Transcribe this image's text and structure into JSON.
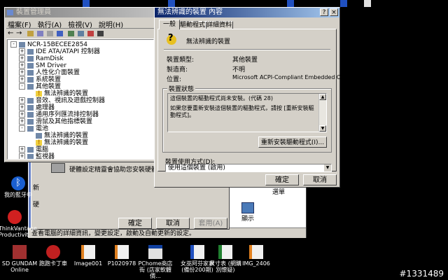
{
  "device_manager": {
    "title": "裝置管理員",
    "menu": [
      "檔案(F)",
      "執行(A)",
      "檢視(V)",
      "說明(H)"
    ],
    "tree": [
      {
        "label": "NCR-15BECEE2854",
        "level": 0,
        "exp": "-"
      },
      {
        "label": "IDE ATA/ATAPI 控制器",
        "level": 1,
        "exp": "+"
      },
      {
        "label": "RamDisk",
        "level": 1,
        "exp": "+"
      },
      {
        "label": "SM Driver",
        "level": 1,
        "exp": "+"
      },
      {
        "label": "人性化介面裝置",
        "level": 1,
        "exp": "+"
      },
      {
        "label": "系統裝置",
        "level": 1,
        "exp": "+"
      },
      {
        "label": "其他裝置",
        "level": 1,
        "exp": "-"
      },
      {
        "label": "無法辨識的裝置",
        "level": 2,
        "exp": "",
        "warn": true
      },
      {
        "label": "音效、視訊及遊戲控制器",
        "level": 1,
        "exp": "+"
      },
      {
        "label": "處理器",
        "level": 1,
        "exp": "+"
      },
      {
        "label": "通用序列匯流排控制器",
        "level": 1,
        "exp": "+"
      },
      {
        "label": "滑鼠及其他指標裝置",
        "level": 1,
        "exp": "+"
      },
      {
        "label": "電池",
        "level": 1,
        "exp": "-"
      },
      {
        "label": "無法辨識的裝置",
        "level": 2,
        "exp": ""
      },
      {
        "label": "無法辨識的裝置",
        "level": 2,
        "exp": "",
        "warn": true
      },
      {
        "label": "電腦",
        "level": 1,
        "exp": "+"
      },
      {
        "label": "監視器",
        "level": 1,
        "exp": "+"
      }
    ]
  },
  "background_dialog": {
    "text": "硬體設定精靈會協助您安裝硬體 (不宜",
    "left_label": "新",
    "left_label2": "硬",
    "ok": "確定",
    "cancel": "取消",
    "apply": "套用(A)"
  },
  "control_panel": {
    "status": "查看電腦的詳細資訊，變更設定，啟動及自動更新的設定。",
    "item_label": "顯示",
    "item_label2": "選單"
  },
  "properties": {
    "title": "無法辨識的裝置 內容",
    "tabs": [
      "一般",
      "驅動程式",
      "詳細資料"
    ],
    "device_name": "無法辨識的裝置",
    "fields": [
      {
        "label": "裝置類型:",
        "value": "其他裝置"
      },
      {
        "label": "製造商:",
        "value": "不明"
      },
      {
        "label": "位置:",
        "value": "Microsoft ACPI-Compliant Embedded Controller"
      }
    ],
    "status_group": "裝置狀態",
    "status_text1": "這個裝置的驅動程式尚未安裝。(代碼 28)",
    "status_text2": "如果您要重新安裝這個裝置的驅動程式，請按 [重新安裝驅動程式]。",
    "reinstall_button": "重新安裝驅動程式(I)...",
    "usage_label": "裝置使用方式(D):",
    "usage_value": "使用這個裝置 (啟用)",
    "ok": "確定",
    "cancel": "取消"
  },
  "desktop": {
    "left_icons": [
      {
        "label": "我的藍牙中",
        "icon": "bluetooth-icon",
        "color": "#1a5fd0"
      },
      {
        "label": "ThinkVantage Productivit...",
        "icon": "thinkvantage-icon",
        "color": "#d02020"
      }
    ],
    "bottom_icons": [
      {
        "label": "SD GUNDAM Online",
        "icon": "gundam-icon",
        "color": "#a03030"
      },
      {
        "label": "跑跑卡丁車",
        "icon": "kart-icon",
        "color": "#c02020"
      },
      {
        "label": "Image001",
        "icon": "image-file-icon",
        "color": "#e08020"
      },
      {
        "label": "P1020978",
        "icon": "image-file-icon",
        "color": "#e08020"
      },
      {
        "label": "PChome商店街 (店家軟體價...",
        "icon": "pchome-icon",
        "color": "#1040a0"
      },
      {
        "label": "女巫阿芬家事 (備份200期)",
        "icon": "word-icon",
        "color": "#2050c0"
      },
      {
        "label": "尺寸表 (網購別懷疑)",
        "icon": "spreadsheet-icon",
        "color": "#208030"
      },
      {
        "label": "IMG_2406",
        "icon": "image-file-icon",
        "color": "#e08020"
      }
    ],
    "watermark": "#1331489"
  }
}
